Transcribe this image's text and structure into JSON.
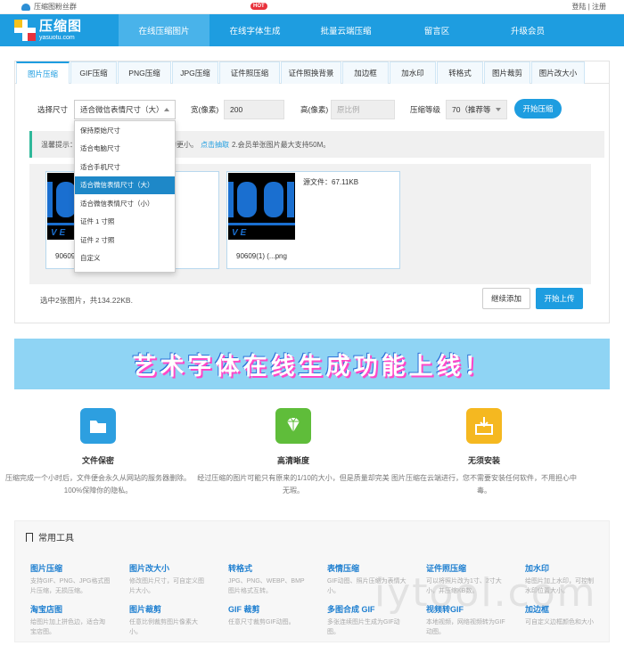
{
  "topbar": {
    "fans_label": "压缩图粉丝群",
    "login": "登陆",
    "sep": "|",
    "register": "注册"
  },
  "logo": {
    "cn": "压缩图",
    "en": "yasuotu.com"
  },
  "nav": {
    "items": [
      "在线压缩图片",
      "在线字体生成",
      "批量云端压缩",
      "留言区",
      "升级会员"
    ],
    "hot_badge": "HOT"
  },
  "tabs": [
    "图片压缩",
    "GIF压缩",
    "PNG压缩",
    "JPG压缩",
    "证件照压缩",
    "证件照换背景",
    "加边框",
    "加水印",
    "转格式",
    "图片裁剪",
    "图片改大小"
  ],
  "options": {
    "size_label": "选择尺寸",
    "size_value": "适合微信表情尺寸（大）",
    "width_label": "宽(像素)",
    "width_value": "200",
    "height_label": "高(像素)",
    "height_placeholder": "原比例",
    "level_label": "压缩等级",
    "level_value": "70（推荐等",
    "start_label": "开始压缩"
  },
  "tip": {
    "prefix": "温馨提示：",
    "mid": "压缩的更小。",
    "link": "点击抽取",
    "suffix": "2.会员单张图片最大支持50M。"
  },
  "dropdown": {
    "items": [
      "保持原始尺寸",
      "适合电脑尺寸",
      "适合手机尺寸",
      "适合微信表情尺寸（大）",
      "适合微信表情尺寸（小）",
      "证件 1 寸照",
      "证件 2 寸照",
      "自定义"
    ],
    "selected_index": 3
  },
  "files": [
    {
      "name": "90609",
      "size": ""
    },
    {
      "name": "90609(1) (...png",
      "size": "源文件：67.11KB"
    }
  ],
  "summary": "选中2张图片，共134.22KB.",
  "actions": {
    "continue": "继续添加",
    "upload": "开始上传"
  },
  "banner": {
    "text": "艺术字体在线生成功能上线！"
  },
  "features": [
    {
      "title": "文件保密",
      "desc": "压缩完成一个小时后，文件便会永久从网站的服务器删除。100%保障你的隐私。",
      "color": "#2d9fe0"
    },
    {
      "title": "高清晰度",
      "desc": "经过压缩的图片可能只有原来的1/10的大小，但是质量却完美无瑕。",
      "color": "#5fbd3a"
    },
    {
      "title": "无须安装",
      "desc": "图片压缩在云端进行，您不需要安装任何软件，不用担心中毒。",
      "color": "#f5b820"
    }
  ],
  "tools": {
    "header": "常用工具",
    "items": [
      {
        "title": "图片压缩",
        "desc": "支持GIF、PNG、JPG格式图片压缩，无损压缩。"
      },
      {
        "title": "图片改大小",
        "desc": "修改图片尺寸，可自定义图片大小。"
      },
      {
        "title": "转格式",
        "desc": "JPG、PNG、WEBP、BMP图片格式互转。"
      },
      {
        "title": "表情压缩",
        "desc": "GIF动图、照片压缩为表情大小。"
      },
      {
        "title": "证件照压缩",
        "desc": "可以将照片改为1寸、2寸大小，并压缩KB数。"
      },
      {
        "title": "加水印",
        "desc": "给图片加上水印，可控制水印位置大小。"
      },
      {
        "title": "淘宝店图",
        "desc": "给图片加上拼色边，适合淘宝店图。"
      },
      {
        "title": "图片裁剪",
        "desc": "任意比例裁剪图片像素大小。"
      },
      {
        "title": "GIF 裁剪",
        "desc": "任意尺寸裁剪GIF动图。"
      },
      {
        "title": "多图合成 GIF",
        "desc": "多张连续图片生成为GIF动图。"
      },
      {
        "title": "视频转GIF",
        "desc": "本地视频，网络视频转为GIF动图。"
      },
      {
        "title": "加边框",
        "desc": "可自定义边框颜色和大小"
      }
    ]
  },
  "watermark": "iytool.com"
}
